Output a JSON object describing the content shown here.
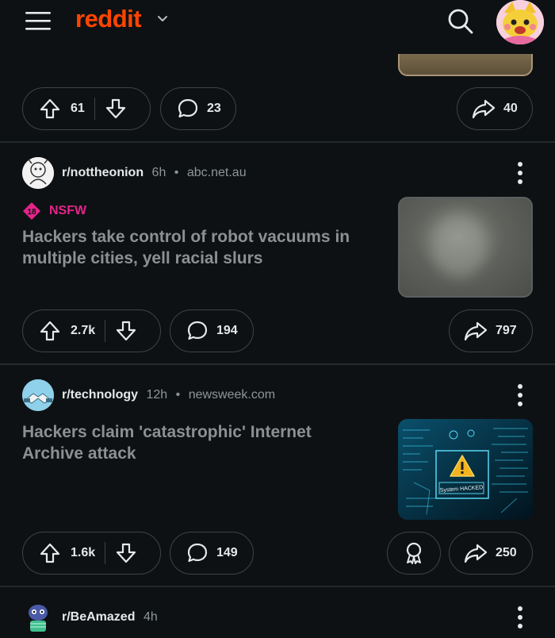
{
  "app": {
    "logo_text": "reddit",
    "brand_color": "#ff4500"
  },
  "header": {
    "menu_icon": "hamburger-menu-icon",
    "chevron_icon": "chevron-down-icon",
    "search_icon": "search-icon"
  },
  "posts": [
    {
      "upvotes": "61",
      "comments": "23",
      "shares": "40"
    },
    {
      "subreddit": "r/nottheonion",
      "age": "6h",
      "separator": "•",
      "domain": "abc.net.au",
      "nsfw_badge": "18",
      "nsfw_label": "NSFW",
      "nsfw_color": "#e5238b",
      "title": "Hackers take control of robot vacuums in multiple cities, yell racial slurs",
      "upvotes": "2.7k",
      "comments": "194",
      "shares": "797"
    },
    {
      "subreddit": "r/technology",
      "age": "12h",
      "separator": "•",
      "domain": "newsweek.com",
      "title": "Hackers claim 'catastrophic' Internet Archive attack",
      "thumb_caption": "System HACKED",
      "upvotes": "1.6k",
      "comments": "149",
      "shares": "250"
    },
    {
      "subreddit": "r/BeAmazed",
      "age": "4h"
    }
  ]
}
